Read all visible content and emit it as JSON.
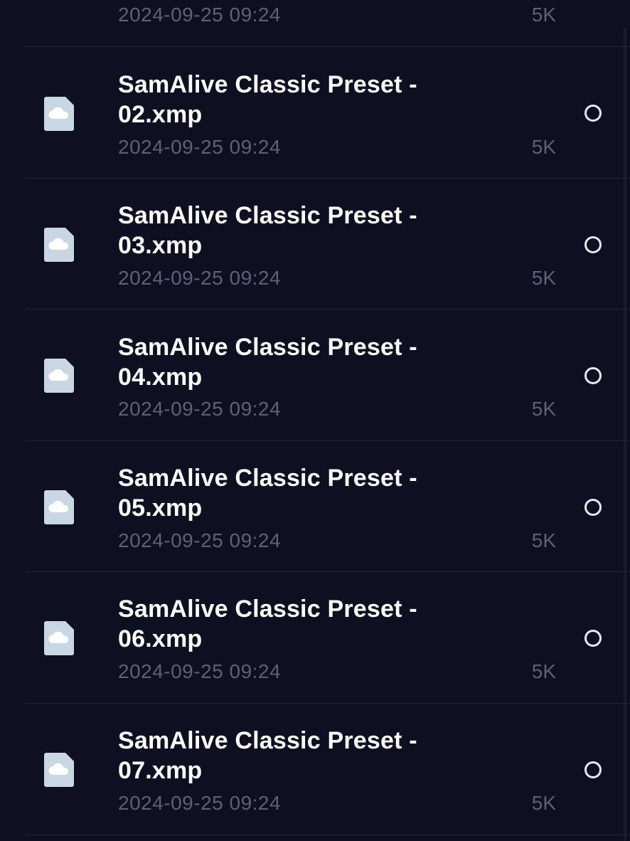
{
  "list": {
    "partial_top_item": {
      "date": "2024-09-25 09:24",
      "size": "5K"
    },
    "items": [
      {
        "name_line1": "SamAlive Classic Preset -",
        "name_line2": "02.xmp",
        "date": "2024-09-25 09:24",
        "size": "5K",
        "selected": false,
        "icon": "cloud-file-icon"
      },
      {
        "name_line1": "SamAlive Classic Preset -",
        "name_line2": "03.xmp",
        "date": "2024-09-25 09:24",
        "size": "5K",
        "selected": false,
        "icon": "cloud-file-icon"
      },
      {
        "name_line1": "SamAlive Classic Preset -",
        "name_line2": "04.xmp",
        "date": "2024-09-25 09:24",
        "size": "5K",
        "selected": false,
        "icon": "cloud-file-icon"
      },
      {
        "name_line1": "SamAlive Classic Preset -",
        "name_line2": "05.xmp",
        "date": "2024-09-25 09:24",
        "size": "5K",
        "selected": false,
        "icon": "cloud-file-icon"
      },
      {
        "name_line1": "SamAlive Classic Preset -",
        "name_line2": "06.xmp",
        "date": "2024-09-25 09:24",
        "size": "5K",
        "selected": false,
        "icon": "cloud-file-icon"
      },
      {
        "name_line1": "SamAlive Classic Preset -",
        "name_line2": "07.xmp",
        "date": "2024-09-25 09:24",
        "size": "5K",
        "selected": false,
        "icon": "cloud-file-icon"
      }
    ]
  },
  "colors": {
    "background": "#0f0f22",
    "icon_fill": "#c9d6e3",
    "meta_text": "#5f5f76",
    "divider": "#23233a"
  }
}
